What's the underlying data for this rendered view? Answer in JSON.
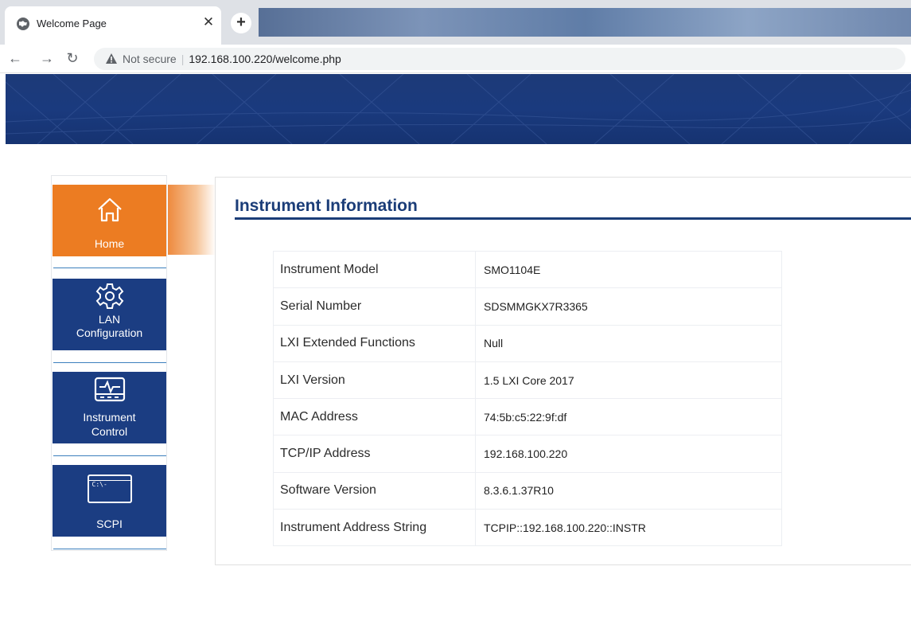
{
  "browser": {
    "tab_title": "Welcome Page",
    "security_label": "Not secure",
    "url": "192.168.100.220/welcome.php"
  },
  "sidebar": {
    "items": [
      {
        "label": "Home",
        "icon": "home-icon",
        "active": true
      },
      {
        "label": "LAN Configuration",
        "label_line1": "LAN",
        "label_line2": "Configuration",
        "icon": "gear-icon",
        "active": false
      },
      {
        "label": "Instrument Control",
        "label_line1": "Instrument",
        "label_line2": "Control",
        "icon": "monitor-pulse-icon",
        "active": false
      },
      {
        "label": "SCPI",
        "icon": "terminal-icon",
        "icon_text": "C:\\-",
        "active": false
      }
    ]
  },
  "main": {
    "title": "Instrument Information",
    "rows": [
      {
        "key": "Instrument Model",
        "value": "SMO1104E"
      },
      {
        "key": "Serial Number",
        "value": "SDSMMGKX7R3365"
      },
      {
        "key": "LXI Extended Functions",
        "value": "Null"
      },
      {
        "key": "LXI Version",
        "value": "1.5 LXI Core 2017"
      },
      {
        "key": "MAC Address",
        "value": "74:5b:c5:22:9f:df"
      },
      {
        "key": "TCP/IP Address",
        "value": "192.168.100.220"
      },
      {
        "key": "Software Version",
        "value": "8.3.6.1.37R10"
      },
      {
        "key": "Instrument Address String",
        "value": "TCPIP::192.168.100.220::INSTR"
      }
    ]
  },
  "colors": {
    "banner": "#1a3a7e",
    "nav_active": "#ec7c22",
    "nav_inactive": "#1b3d82",
    "title": "#1b3d78"
  }
}
